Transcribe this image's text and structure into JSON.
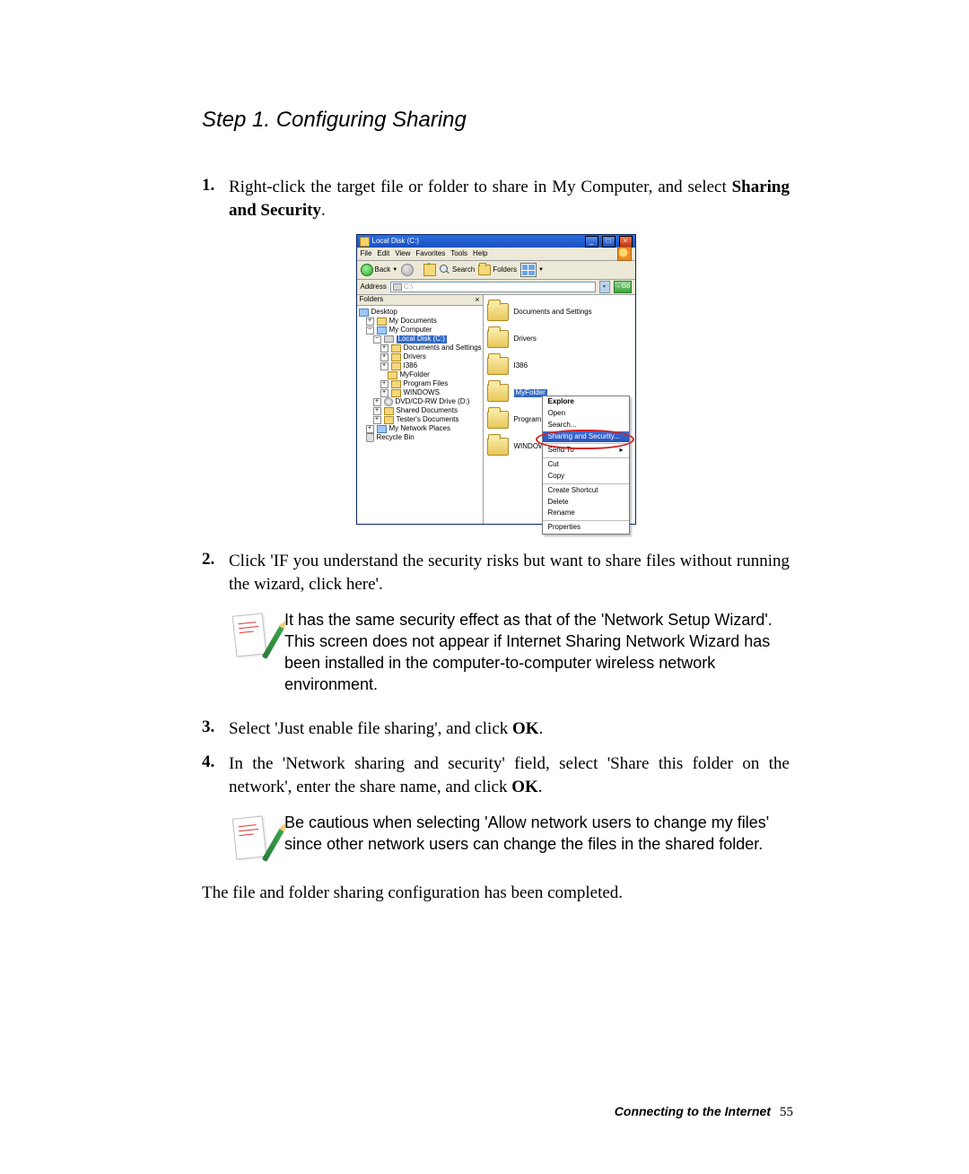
{
  "title": "Step 1. Configuring Sharing",
  "steps": {
    "s1": {
      "num": "1.",
      "pre": "Right-click the target file or folder to share in My Computer, and select ",
      "bold": "Sharing and Security",
      "post": "."
    },
    "s2": {
      "num": "2.",
      "text": "Click 'IF you understand the security risks but want to share files without running the wizard, click here'."
    },
    "s3": {
      "num": "3.",
      "pre": "Select 'Just enable file sharing', and click ",
      "bold": "OK",
      "post": "."
    },
    "s4": {
      "num": "4.",
      "pre": "In the 'Network sharing and security' field, select 'Share this folder on the network', enter the share name, and click ",
      "bold": "OK",
      "post": "."
    }
  },
  "note1": "It has the same security effect as that of the 'Network Setup Wizard'. This screen does not appear if Internet Sharing Network Wizard has been installed in the computer-to-computer wireless network environment.",
  "note2": "Be cautious when selecting 'Allow network users to change my files' since other network users can change the files in the shared folder.",
  "final": "The file and folder sharing configuration has been completed.",
  "footer": {
    "section": "Connecting to the Internet",
    "page": "55"
  },
  "xp": {
    "title": "Local Disk (C:)",
    "menu": {
      "file": "File",
      "edit": "Edit",
      "view": "View",
      "favorites": "Favorites",
      "tools": "Tools",
      "help": "Help"
    },
    "toolbar": {
      "back": "Back",
      "search": "Search",
      "folders": "Folders"
    },
    "address": {
      "label": "Address",
      "value": "C:\\",
      "go": "Go"
    },
    "foldersPane": "Folders",
    "tree": {
      "desktop": "Desktop",
      "mydocs": "My Documents",
      "mycomp": "My Computer",
      "cdisk": "Local Disk (C:)",
      "docset": "Documents and Settings",
      "drivers": "Drivers",
      "i386": "I386",
      "myfolder": "MyFolder",
      "progfiles": "Program Files",
      "windows": "WINDOWS",
      "dvd": "DVD/CD-RW Drive (D:)",
      "shared": "Shared Documents",
      "tester": "Tester's Documents",
      "netplaces": "My Network Places",
      "recycle": "Recycle Bin"
    },
    "right": {
      "docset": "Documents and Settings",
      "drivers": "Drivers",
      "i386": "I386",
      "myfolder": "MyFolder",
      "progfiles": "Program F",
      "windows": "WINDOW"
    },
    "ctx": {
      "explore": "Explore",
      "open": "Open",
      "search": "Search...",
      "sharing": "Sharing and Security...",
      "sendto": "Send To",
      "cut": "Cut",
      "copy": "Copy",
      "shortcut": "Create Shortcut",
      "delete": "Delete",
      "rename": "Rename",
      "props": "Properties"
    }
  }
}
